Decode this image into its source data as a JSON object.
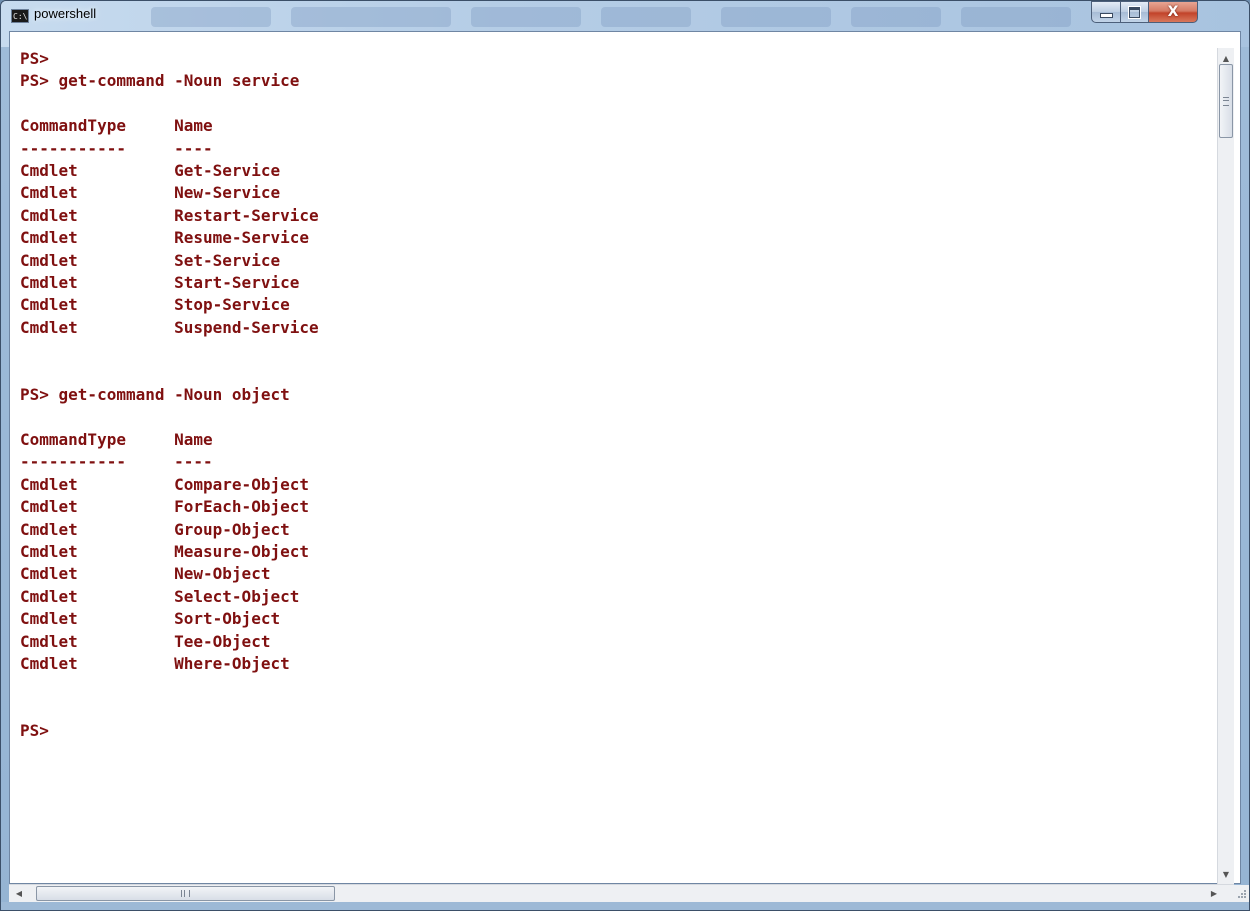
{
  "window": {
    "title": "powershell",
    "icon_label": "C:\\"
  },
  "controls": {
    "minimize": "minimize-icon",
    "maximize": "maximize-icon",
    "close_glyph": "X"
  },
  "console": {
    "text": "PS>\nPS> get-command -Noun service\n\nCommandType     Name\n-----------     ----\nCmdlet          Get-Service\nCmdlet          New-Service\nCmdlet          Restart-Service\nCmdlet          Resume-Service\nCmdlet          Set-Service\nCmdlet          Start-Service\nCmdlet          Stop-Service\nCmdlet          Suspend-Service\n\n\nPS> get-command -Noun object\n\nCommandType     Name\n-----------     ----\nCmdlet          Compare-Object\nCmdlet          ForEach-Object\nCmdlet          Group-Object\nCmdlet          Measure-Object\nCmdlet          New-Object\nCmdlet          Select-Object\nCmdlet          Sort-Object\nCmdlet          Tee-Object\nCmdlet          Where-Object\n\n\nPS>",
    "text_color": "#7f1010",
    "background_color": "#ffffff"
  },
  "scrollbars": {
    "up_arrow": "▲",
    "down_arrow": "▼",
    "left_arrow": "◀",
    "right_arrow": "▶"
  }
}
